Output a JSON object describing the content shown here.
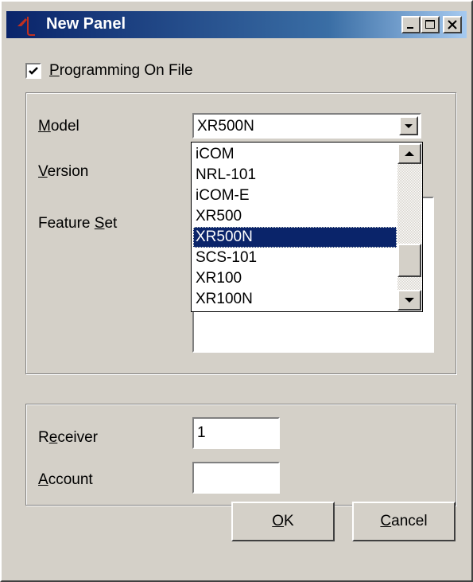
{
  "window": {
    "title": "New Panel"
  },
  "programming_on_file": {
    "label_mnemonic": "P",
    "label_rest": "rogramming On File",
    "checked": true
  },
  "model": {
    "label_mnemonic": "M",
    "label_rest": "odel",
    "selected": "XR500N",
    "options": [
      "iCOM",
      "NRL-101",
      "iCOM-E",
      "XR500",
      "XR500N",
      "SCS-101",
      "XR100",
      "XR100N"
    ]
  },
  "version": {
    "label_mnemonic": "V",
    "label_rest": "ersion"
  },
  "feature_set": {
    "label_before": "Feature ",
    "label_mnemonic": "S",
    "label_rest": "et"
  },
  "receiver": {
    "label_before": "R",
    "label_mnemonic": "e",
    "label_rest": "ceiver",
    "value": "1"
  },
  "account": {
    "label_mnemonic": "A",
    "label_rest": "ccount",
    "value": ""
  },
  "buttons": {
    "ok_mnemonic": "O",
    "ok_rest": "K",
    "cancel_mnemonic": "C",
    "cancel_rest": "ancel"
  },
  "colors": {
    "titlebar": "#0a246a",
    "selection": "#0a246a",
    "face": "#d4d0c8"
  }
}
